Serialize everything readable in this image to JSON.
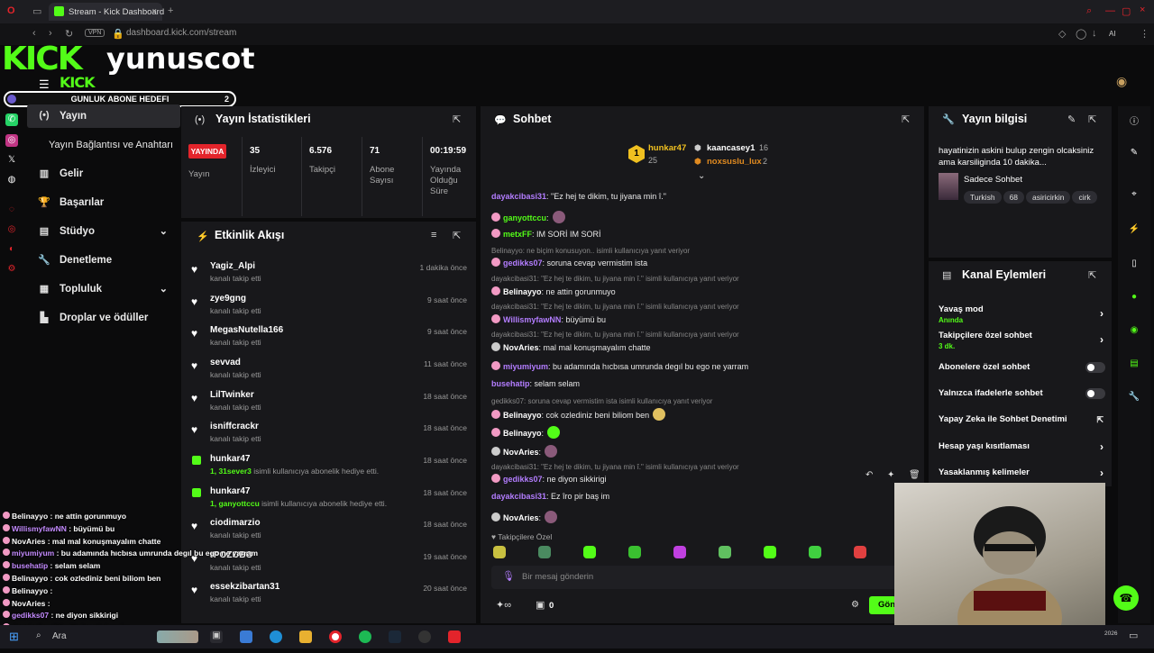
{
  "browser": {
    "tab_title": "Stream - Kick Dashboard",
    "url": "dashboard.kick.com/stream",
    "vpn_label": "VPN",
    "ai_label": "AI"
  },
  "overlay": {
    "logo": "KICK",
    "logo_small": "KICK",
    "channel_name": "yunuscot",
    "goal_label": "GUNLUK ABONE HEDEFI",
    "goal_value": "2"
  },
  "nav": {
    "items": [
      {
        "label": "Yayın",
        "icon": "play-icon"
      },
      {
        "label": "Yayın Bağlantısı ve Anahtarı",
        "icon": ""
      },
      {
        "label": "Gelir",
        "icon": "chart-icon"
      },
      {
        "label": "Başarılar",
        "icon": "trophy-icon"
      },
      {
        "label": "Stüdyo",
        "icon": "studio-icon"
      },
      {
        "label": "Denetleme",
        "icon": "wrench-icon"
      },
      {
        "label": "Topluluk",
        "icon": "community-icon"
      },
      {
        "label": "Droplar ve ödüller",
        "icon": "drops-icon"
      }
    ]
  },
  "stats": {
    "title": "Yayın İstatistikleri",
    "live_badge": "YAYINDA",
    "live_label": "Yayın",
    "cols": [
      {
        "value": "35",
        "label": "İzleyici"
      },
      {
        "value": "6.576",
        "label": "Takipçi"
      },
      {
        "value": "71",
        "label": "Abone Sayısı"
      },
      {
        "value": "00:19:59",
        "label": "Yayında Olduğu Süre"
      }
    ]
  },
  "activity": {
    "title": "Etkinlik Akışı",
    "items": [
      {
        "user": "Yagiz_Alpi",
        "text": "kanalı takip etti",
        "time": "1 dakika önce",
        "type": "follow"
      },
      {
        "user": "zye9gng",
        "text": "kanalı takip etti",
        "time": "9 saat önce",
        "type": "follow"
      },
      {
        "user": "MegasNutella166",
        "text": "kanalı takip etti",
        "time": "9 saat önce",
        "type": "follow"
      },
      {
        "user": "sevvad",
        "text": "kanalı takip etti",
        "time": "11 saat önce",
        "type": "follow"
      },
      {
        "user": "LilTwinker",
        "text": "kanalı takip etti",
        "time": "18 saat önce",
        "type": "follow"
      },
      {
        "user": "isniffcrackr",
        "text": "kanalı takip etti",
        "time": "18 saat önce",
        "type": "follow"
      },
      {
        "user": "hunkar47",
        "highlight": "1, 31sever3",
        "text": " isimli kullanıcıya abonelik hediye etti.",
        "time": "18 saat önce",
        "type": "gift"
      },
      {
        "user": "hunkar47",
        "highlight": "1, ganyottccu",
        "text": " isimli kullanıcıya abonelik hediye etti.",
        "time": "18 saat önce",
        "type": "gift"
      },
      {
        "user": "ciodimarzio",
        "text": "kanalı takip etti",
        "time": "18 saat önce",
        "type": "follow"
      },
      {
        "user": "rPOZOBO",
        "text": "kanalı takip etti",
        "time": "19 saat önce",
        "type": "follow"
      },
      {
        "user": "essekzibartan31",
        "text": "kanalı takip etti",
        "time": "20 saat önce",
        "type": "follow"
      }
    ]
  },
  "chat": {
    "title": "Sohbet",
    "pinned_top": [
      {
        "rank": "1",
        "name": "hunkar47",
        "count": "25"
      },
      {
        "name": "kaancasey1",
        "count": "16"
      },
      {
        "name": "noxsuslu_lux",
        "count": "2"
      }
    ],
    "messages": [
      {
        "reply": "",
        "user": "dayakcibasi31",
        "color": "#b37dff",
        "text": ": \"Ez hej te dikim, tu jiyana min î.\"",
        "emote": ""
      },
      {
        "reply": "",
        "user": "ganyottccu",
        "color": "#53fc18",
        "text": ":",
        "emote": "#8a5a7a"
      },
      {
        "reply": "",
        "user": "metxFF",
        "color": "#53fc18",
        "text": ": IM SORİ IM SORİ",
        "emote": ""
      },
      {
        "reply": "Belinayyo: ne biçim konusuyon.. isimli kullanıcıya yanıt veriyor",
        "user": "gedikks07",
        "color": "#b37dff",
        "text": ": soruna cevap vermistim ista",
        "emote": ""
      },
      {
        "reply": "dayakcibasi31: \"Ez hej te dikim, tu jiyana min î.\" isimli kullanıcıya yanıt veriyor",
        "user": "Belinayyo",
        "color": "#fff",
        "text": ": ne attin gorunmuyo",
        "emote": ""
      },
      {
        "reply": "dayakcibasi31: \"Ez hej te dikim, tu jiyana min î.\" isimli kullanıcıya yanıt veriyor",
        "user": "WillismyfawNN",
        "color": "#b37dff",
        "text": ": büyümü bu",
        "emote": ""
      },
      {
        "reply": "dayakcibasi31: \"Ez hej te dikim, tu jiyana min î.\" isimli kullanıcıya yanıt veriyor",
        "user": "NovAries",
        "color": "#fff",
        "text": ": mal mal konuşmayalım chatte",
        "emote": ""
      },
      {
        "reply": "",
        "user": "miyumiyum",
        "color": "#b37dff",
        "text": ": bu adamında hıcbısa umrunda degıl bu ego ne yarram",
        "emote": ""
      },
      {
        "reply": "",
        "user": "busehatip",
        "color": "#b37dff",
        "text": ": selam selam",
        "emote": ""
      },
      {
        "reply": "gedikks07: soruna cevap vermistim ista isimli kullanıcıya yanıt veriyor",
        "user": "Belinayyo",
        "color": "#fff",
        "text": ": cok ozlediniz beni biliom ben",
        "emote": "#e0c060"
      },
      {
        "reply": "",
        "user": "Belinayyo",
        "color": "#fff",
        "text": ":",
        "emote": "#53fc18"
      },
      {
        "reply": "",
        "user": "NovAries",
        "color": "#fff",
        "text": ":",
        "emote": "#8a5a7a"
      },
      {
        "reply": "dayakcibasi31: \"Ez hej te dikim, tu jiyana min î.\" isimli kullanıcıya yanıt veriyor",
        "user": "gedikks07",
        "color": "#b37dff",
        "text": ": ne diyon sikkirigi",
        "emote": ""
      },
      {
        "reply": "",
        "user": "dayakcibasi31",
        "color": "#b37dff",
        "text": ": Ez îro pir baş im",
        "emote": ""
      },
      {
        "reply": "",
        "user": "NovAries",
        "color": "#fff",
        "text": ":",
        "emote": "#8a5a7a"
      }
    ],
    "followers_only_label": "Takipçilere Özel",
    "input_placeholder": "Bir mesaj gönderin",
    "points": "0",
    "send_label": "Gönder"
  },
  "stream_info": {
    "title": "Yayın bilgisi",
    "stream_title": "hayatinizin askini bulup zengin olcaksiniz ama karsiliginda 10 dakika...",
    "category": "Sadece Sohbet",
    "tags": [
      "Turkish",
      "68",
      "asiricirkin",
      "cirk"
    ]
  },
  "channel_actions": {
    "title": "Kanal Eylemleri",
    "items": [
      {
        "label": "Yavaş mod",
        "sub": "Anında",
        "control": "arrow"
      },
      {
        "label": "Takipçilere özel sohbet",
        "sub": "3 dk.",
        "control": "arrow"
      },
      {
        "label": "Abonelere özel sohbet",
        "sub": "",
        "control": "toggle"
      },
      {
        "label": "Yalnızca ifadelerle sohbet",
        "sub": "",
        "control": "toggle"
      },
      {
        "label": "Yapay Zeka ile Sohbet Denetimi",
        "sub": "",
        "control": "external"
      },
      {
        "label": "Hesap yaşı kısıtlaması",
        "sub": "",
        "control": "arrow"
      },
      {
        "label": "Yasaklanmış kelimeler",
        "sub": "",
        "control": "arrow"
      }
    ]
  },
  "overlay_chat": [
    {
      "user": "Belinayyo",
      "text": " : ne attin gorunmuyo"
    },
    {
      "user": "WillismyfawNN",
      "text": " : büyümü bu"
    },
    {
      "user": "NovAries",
      "text": " : mal mal konuşmayalım chatte"
    },
    {
      "user": "miyumiyum",
      "text": " : bu adamında hıcbısa umrunda degıl bu ego ne yarram"
    },
    {
      "user": "busehatip",
      "text": " : selam selam"
    },
    {
      "user": "Belinayyo",
      "text": " : cok ozlediniz beni biliom ben"
    },
    {
      "user": "Belinayyo",
      "text": " :"
    },
    {
      "user": "NovAries",
      "text": " :"
    },
    {
      "user": "gedikks07",
      "text": " : ne diyon sikkirigi"
    },
    {
      "user": "dayakcibasi31",
      "text": " : Ez îro pir baş im"
    }
  ],
  "taskbar": {
    "search_label": "Ara",
    "clock_year": "2026"
  },
  "colors": {
    "accent": "#53fc18",
    "live": "#e3242b",
    "panel": "#18181b",
    "background": "#0b0b0c"
  }
}
